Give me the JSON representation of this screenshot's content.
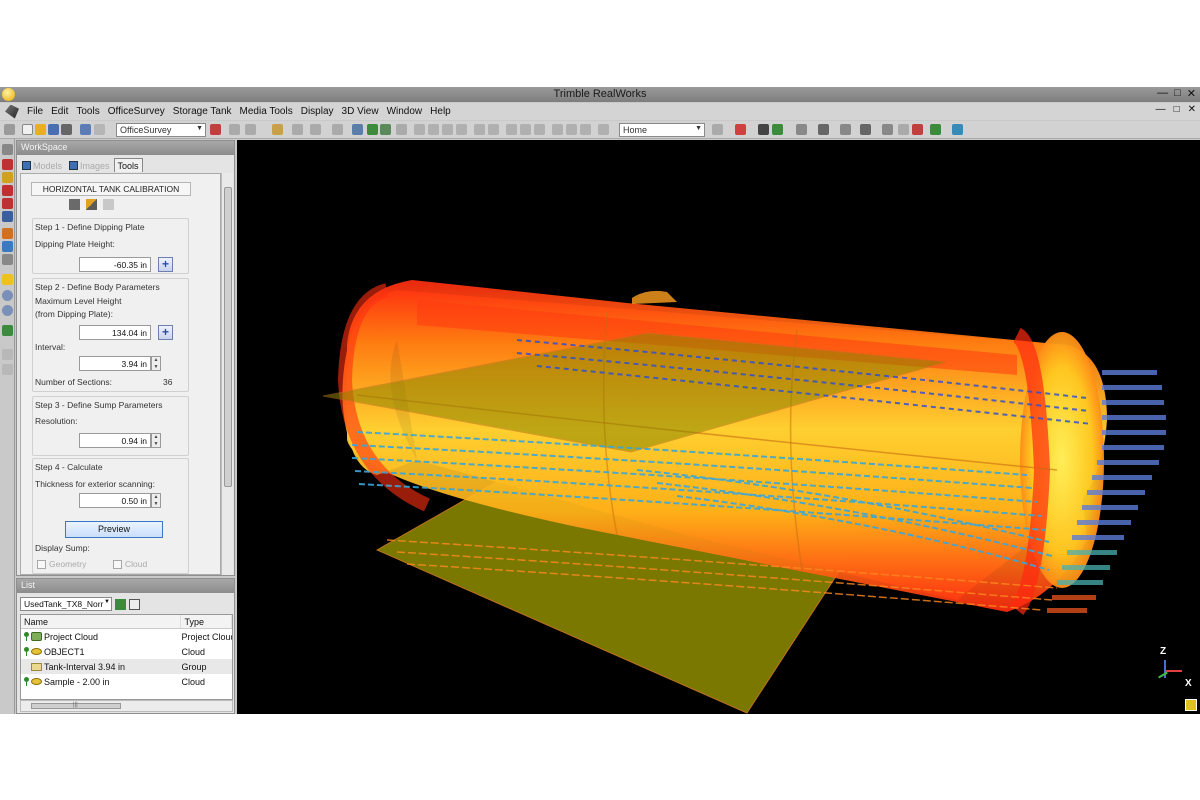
{
  "window": {
    "title": "Trimble RealWorks",
    "controls": [
      "—",
      "□",
      "✕"
    ]
  },
  "menu": {
    "items": [
      "File",
      "Edit",
      "Tools",
      "OfficeSurvey",
      "Storage Tank",
      "Media Tools",
      "Display",
      "3D View",
      "Window",
      "Help"
    ],
    "mdi_controls": [
      "—",
      "□",
      "✕"
    ]
  },
  "toolbar": {
    "module_combo": "OfficeSurvey",
    "view_combo": "Home"
  },
  "workspace": {
    "header": "WorkSpace",
    "tabs": [
      {
        "label": "Models",
        "active": false
      },
      {
        "label": "Images",
        "active": false
      },
      {
        "label": "Tools",
        "active": true
      }
    ],
    "tool_title": "HORIZONTAL TANK CALIBRATION",
    "step1": {
      "title": "Step 1 - Define Dipping Plate",
      "height_label": "Dipping Plate Height:",
      "height_value": "-60.35 in"
    },
    "step2": {
      "title": "Step 2 - Define Body Parameters",
      "max_level_label": "Maximum Level Height",
      "max_level_sub": "(from Dipping Plate):",
      "max_level_value": "134.04 in",
      "interval_label": "Interval:",
      "interval_value": "3.94 in",
      "sections_label": "Number of Sections:",
      "sections_value": "36"
    },
    "step3": {
      "title": "Step 3 - Define Sump Parameters",
      "resolution_label": "Resolution:",
      "resolution_value": "0.94 in"
    },
    "step4": {
      "title": "Step 4 - Calculate",
      "thickness_label": "Thickness for exterior scanning:",
      "thickness_value": "0.50 in",
      "preview_button": "Preview",
      "display_sump_label": "Display Sump:",
      "geometry_label": "Geometry",
      "cloud_label": "Cloud"
    }
  },
  "list": {
    "header": "List",
    "combo": "UsedTank_TX8_Norr",
    "columns": [
      "Name",
      "Type"
    ],
    "rows": [
      {
        "name": "Project Cloud",
        "type": "Project Cloud",
        "icon": "project-cloud-icon"
      },
      {
        "name": "OBJECT1",
        "type": "Cloud",
        "icon": "cloud-icon"
      },
      {
        "name": "Tank-Interval 3.94 in",
        "type": "Group",
        "icon": "group-icon"
      },
      {
        "name": "Sample - 2.00 in",
        "type": "Cloud",
        "icon": "cloud-icon"
      }
    ]
  },
  "viewport": {
    "axis_labels": {
      "z": "Z",
      "x": "X"
    },
    "colors": {
      "background": "#000000",
      "plane": "#7a7800",
      "tank_hot": "#ff2a10",
      "tank_warm": "#ffb000",
      "tank_core": "#ffe24a",
      "scan_lines": "#3aa6d8"
    }
  }
}
